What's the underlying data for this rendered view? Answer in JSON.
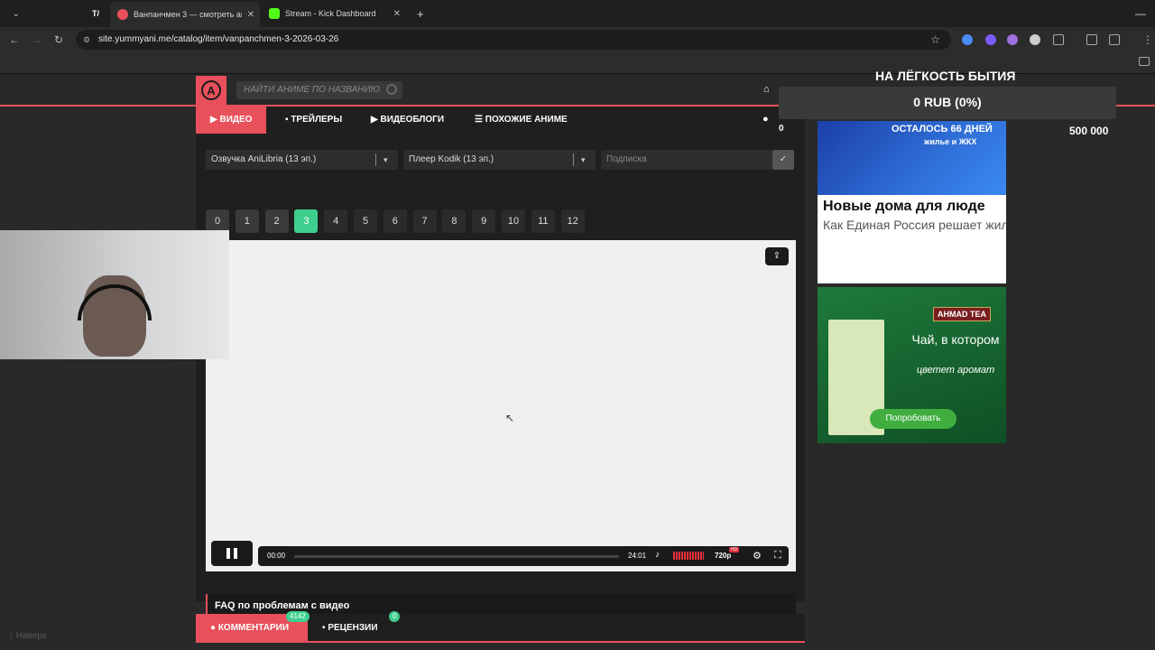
{
  "browser": {
    "tabs": [
      {
        "title": "Ванпанчмен 3 — смотреть ан",
        "active": true
      },
      {
        "title": "Stream - Kick Dashboard",
        "active": false
      }
    ],
    "url": "site.yummyani.me/catalog/item/vanpanchmen-3-2026-03-26"
  },
  "site": {
    "search_placeholder": "НАЙТИ АНИМЕ ПО НАЗВАНИЮ",
    "nav": {
      "video": "ВИДЕО",
      "trailers": "ТРЕЙЛЕРЫ",
      "videoblogs": "ВИДЕОБЛОГИ",
      "similar": "ПОХОЖИЕ АНИМЕ",
      "count": "0"
    },
    "dub_select": "Озвучка AniLibria (13 эп.)",
    "player_select": "Плеер Kodik (13 эп.)",
    "subscribe_placeholder": "Подписка",
    "episodes": [
      "0",
      "1",
      "2",
      "3",
      "4",
      "5",
      "6",
      "7",
      "8",
      "9",
      "10",
      "11",
      "12"
    ],
    "active_episode": 3,
    "player": {
      "time_current": "00:00",
      "time_total": "24:01",
      "quality": "720p",
      "quality_badge": "HD"
    },
    "faq": "FAQ по проблемам с видео",
    "comments_label": "КОММЕНТАРИИ",
    "comments_count": "4142",
    "reviews_label": "РЕЦЕНЗИИ",
    "reviews_count": "0",
    "back_to_top": "↑ Наверх"
  },
  "overlay": {
    "title": "НА ЛЁГКОСТЬ БЫТИЯ",
    "amount": "0 RUB (0%)",
    "goal": "500 000"
  },
  "ads": {
    "ad1_banner": "ОСТАЛОСЬ 66 ДНЕЙ",
    "ad1_banner_sub": "жилье и ЖКХ",
    "ad1_title": "Новые дома для люде",
    "ad1_text": "Как Единая Россия решает жилищную проблему в стран",
    "ad2_brand": "AHMAD TEA",
    "ad2_text": "Чай, в котором",
    "ad2_sub": "цветет аромат",
    "ad2_button": "Попробовать"
  }
}
